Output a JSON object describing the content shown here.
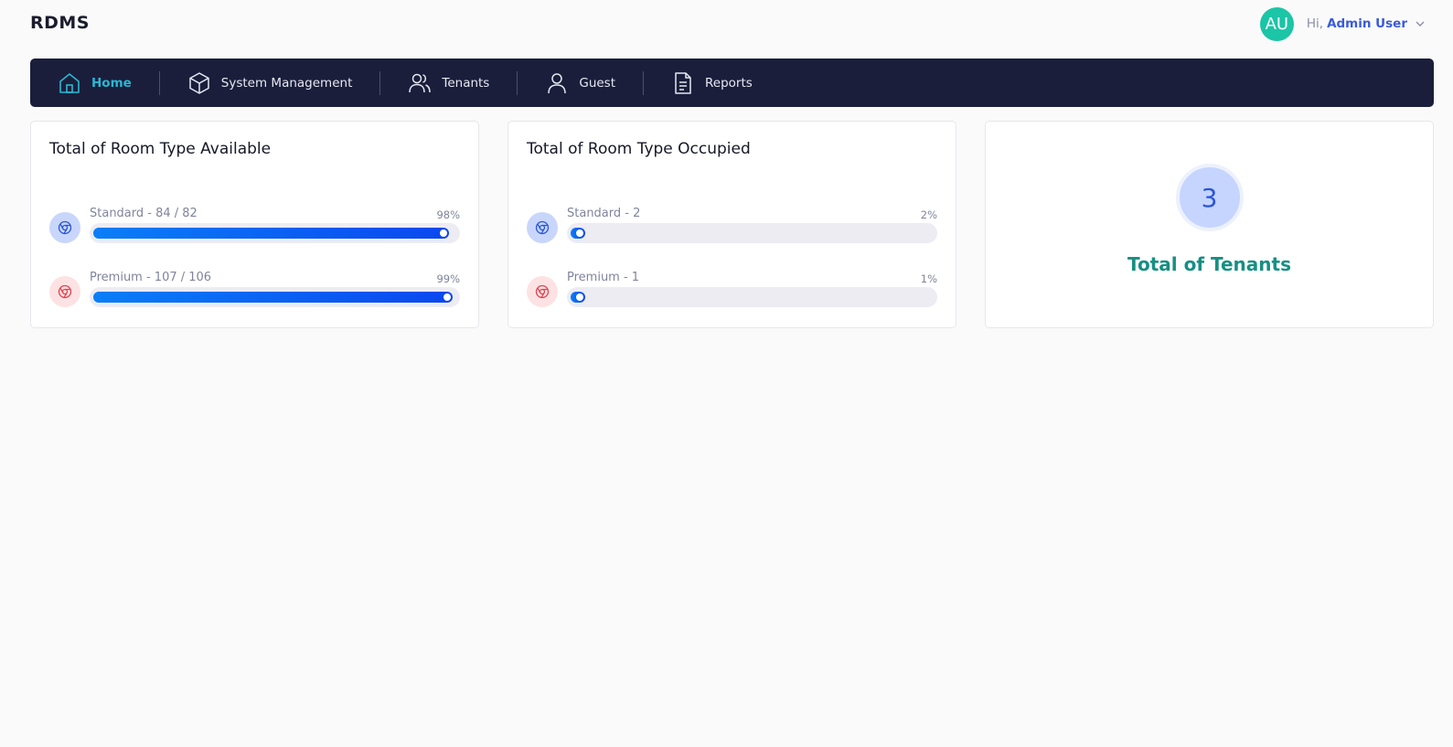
{
  "app": {
    "brand": "RDMS"
  },
  "user": {
    "initials": "AU",
    "greeting": "Hi,",
    "name": "Admin User",
    "avatar_color": "#1bc5a6"
  },
  "nav": {
    "items": [
      {
        "label": "Home",
        "icon": "home-icon",
        "active": true
      },
      {
        "label": "System Management",
        "icon": "cube-icon",
        "active": false
      },
      {
        "label": "Tenants",
        "icon": "users-icon",
        "active": false
      },
      {
        "label": "Guest",
        "icon": "user-icon",
        "active": false
      },
      {
        "label": "Reports",
        "icon": "document-icon",
        "active": false
      }
    ]
  },
  "available": {
    "title": "Total of Room Type Available",
    "rows": [
      {
        "label": "Standard - 84 / 82",
        "percent": "98%",
        "value": 98,
        "icon": "chrome-icon",
        "icon_color": "blue"
      },
      {
        "label": "Premium - 107 / 106",
        "percent": "99%",
        "value": 99,
        "icon": "chrome-icon",
        "icon_color": "red"
      }
    ]
  },
  "occupied": {
    "title": "Total of Room Type Occupied",
    "rows": [
      {
        "label": "Standard - 2",
        "percent": "2%",
        "value": 2,
        "icon": "chrome-icon",
        "icon_color": "blue"
      },
      {
        "label": "Premium - 1",
        "percent": "1%",
        "value": 1,
        "icon": "chrome-icon",
        "icon_color": "red"
      }
    ]
  },
  "tenants": {
    "count": "3",
    "label": "Total of Tenants"
  },
  "colors": {
    "nav_bg": "#1b1e3b",
    "accent": "#27b9d4",
    "bar": "#0a47ef",
    "tenant_label": "#178f83"
  }
}
